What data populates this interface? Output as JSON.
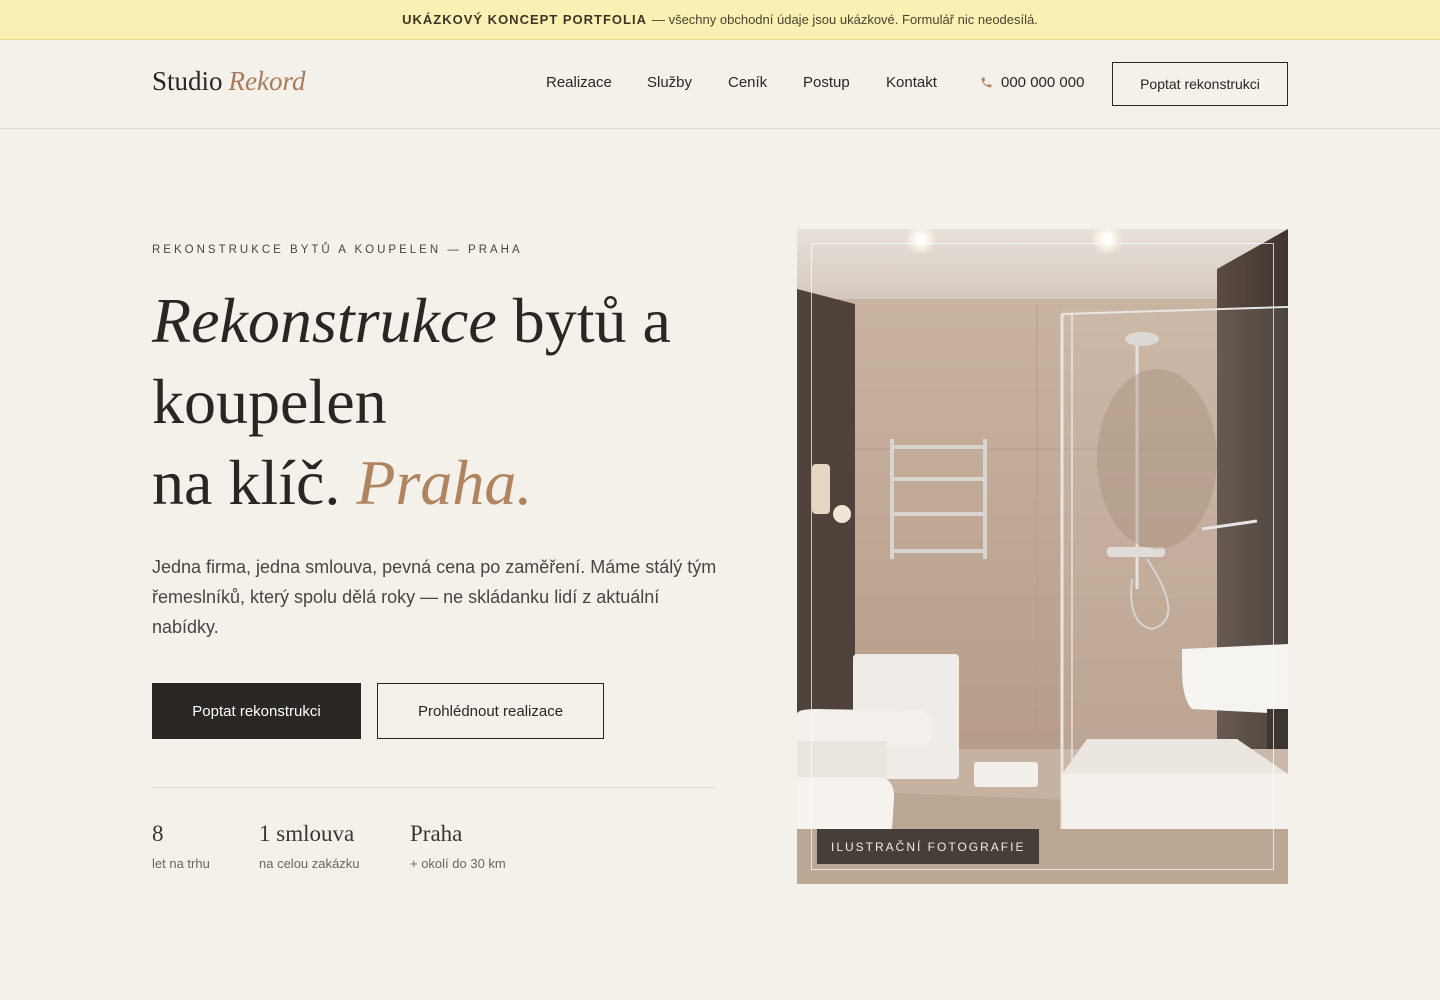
{
  "banner": {
    "strong": "UKÁZKOVÝ KONCEPT PORTFOLIA",
    "text": "— všechny obchodní údaje jsou ukázkové. Formulář nic neodesílá."
  },
  "header": {
    "logo_main": "Studio",
    "logo_accent": "Rekord",
    "nav": [
      "Realizace",
      "Služby",
      "Ceník",
      "Postup",
      "Kontakt"
    ],
    "phone": "000 000 000",
    "phone_icon": "phone-icon",
    "cta": "Poptat rekonstrukci"
  },
  "hero": {
    "eyebrow": "REKONSTRUKCE BYTŮ A KOUPELEN — PRAHA",
    "title_italic": "Rekonstrukce",
    "title_rest1": "bytů a",
    "title_line2": "koupelen",
    "title_line3": "na klíč.",
    "title_accent": "Praha.",
    "lead": "Jedna firma, jedna smlouva, pevná cena po zaměření. Máme stálý tým řemeslníků, který spolu dělá roky — ne skládanku lidí z aktuální nabídky.",
    "primary_button": "Poptat rekonstrukci",
    "secondary_button": "Prohlédnout realizace",
    "stats": [
      {
        "value": "8",
        "label": "let na trhu"
      },
      {
        "value": "1 smlouva",
        "label": "na celou zakázku"
      },
      {
        "value": "Praha",
        "label": "+ okolí do 30 km"
      }
    ],
    "photo_badge": "ILUSTRAČNÍ FOTOGRAFIE"
  },
  "colors": {
    "background": "#f4f0ea",
    "banner": "#faf0b4",
    "accent": "#b0845f",
    "dark": "#2a2624"
  }
}
